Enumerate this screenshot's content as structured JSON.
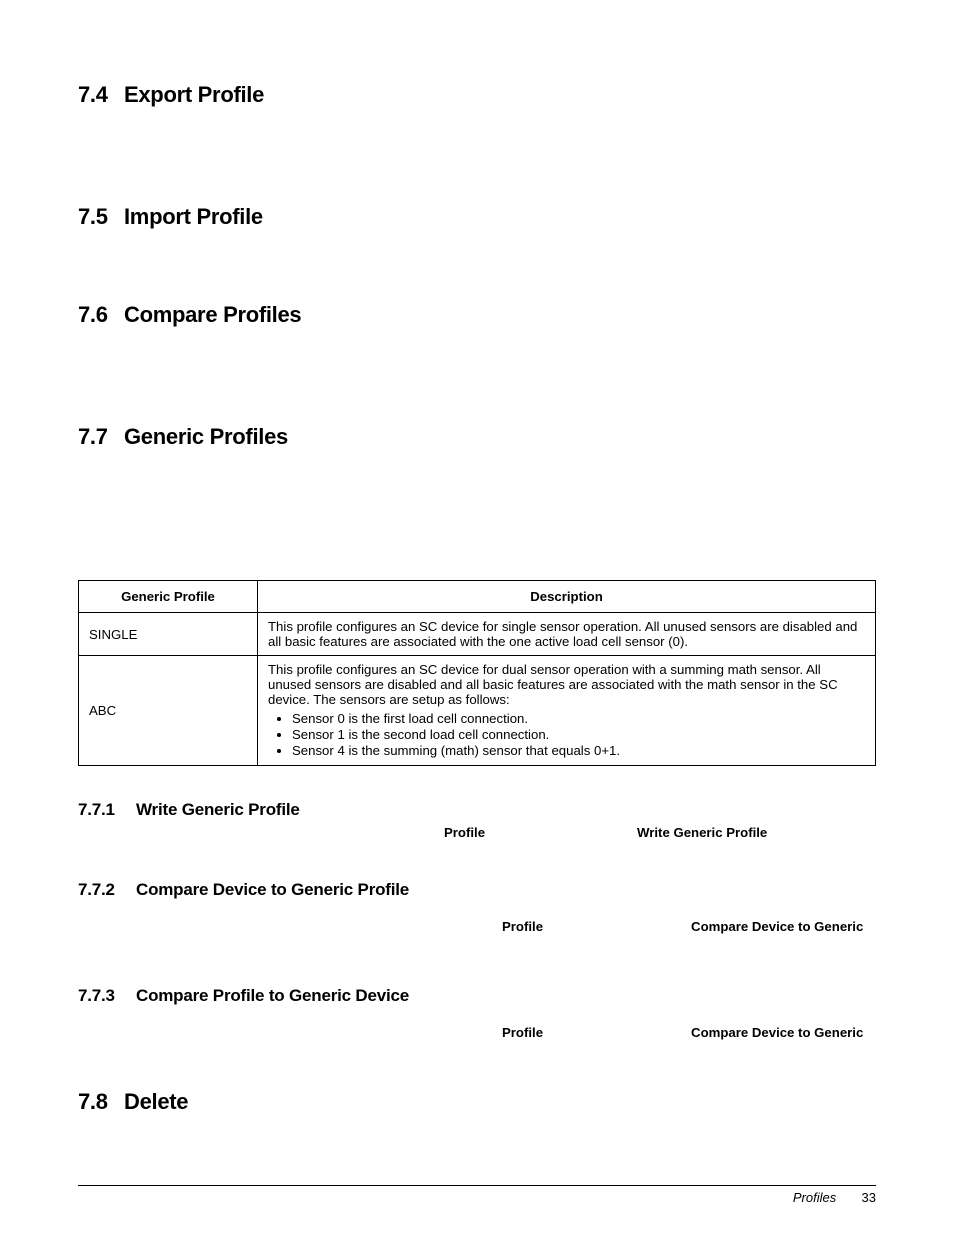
{
  "sections": {
    "s74": {
      "num": "7.4",
      "title": "Export Profile"
    },
    "s75": {
      "num": "7.5",
      "title": "Import Profile"
    },
    "s76": {
      "num": "7.6",
      "title": "Compare Profiles"
    },
    "s77": {
      "num": "7.7",
      "title": "Generic Profiles"
    },
    "s78": {
      "num": "7.8",
      "title": "Delete"
    }
  },
  "table": {
    "header": {
      "col_a": "Generic Profile",
      "col_b": "Description"
    },
    "rows": {
      "r1": {
        "name": "SINGLE",
        "desc": "This profile configures an SC device for single sensor operation. All unused sensors are disabled and all basic features are associated with the one active load cell sensor (0)."
      },
      "r2": {
        "name": "ABC",
        "desc_intro": "This profile configures an SC device for dual sensor operation with a summing math sensor.  All unused sensors are disabled and all basic features are associated with the math sensor in the SC device.  The sensors are setup as follows:",
        "bullets": {
          "b1": "Sensor 0 is the first load cell connection.",
          "b2": "Sensor 1 is the second load cell connection.",
          "b3": "Sensor 4 is the summing (math) sensor that equals 0+1."
        }
      }
    }
  },
  "subs": {
    "s771": {
      "num": "7.7.1",
      "title": "Write Generic Profile"
    },
    "s772": {
      "num": "7.7.2",
      "title": "Compare Device to Generic Profile"
    },
    "s773": {
      "num": "7.7.3",
      "title": "Compare Profile to Generic Device"
    }
  },
  "bodylines": {
    "l771_profile": "Profile",
    "l771_action": "Write Generic Profile",
    "l772_profile": "Profile",
    "l772_action": "Compare Device to Generic",
    "l773_profile": "Profile",
    "l773_action": "Compare Device to Generic"
  },
  "footer": {
    "section": "Profiles",
    "page": "33"
  }
}
